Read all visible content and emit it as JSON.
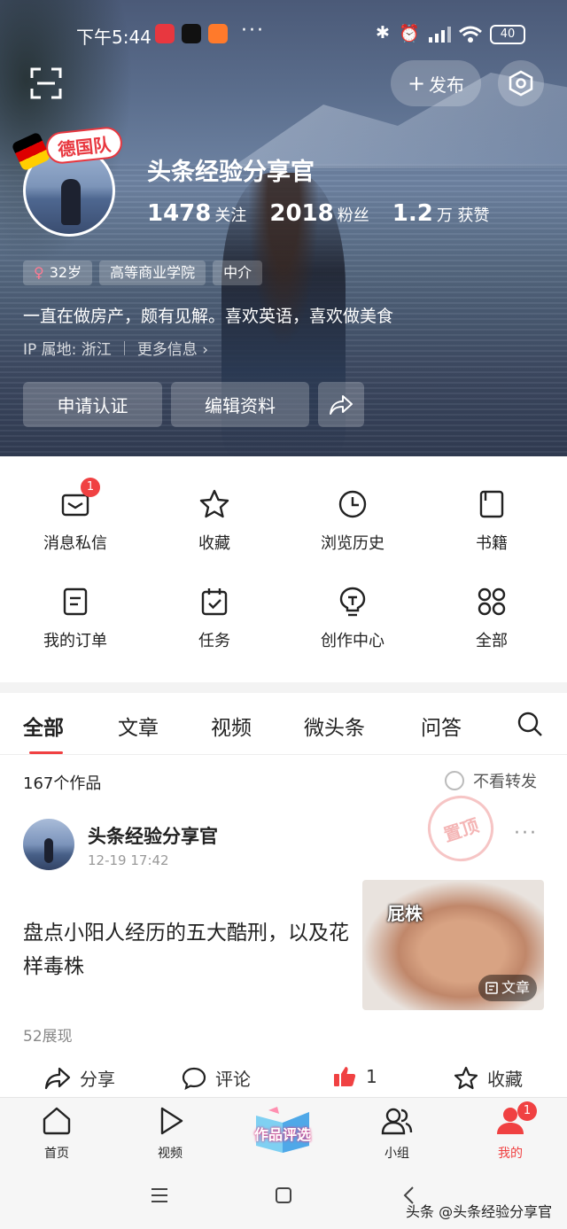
{
  "status_bar": {
    "time": "下午5:44",
    "more": "···",
    "battery": "40"
  },
  "header": {
    "publish_label": "发布",
    "badge_text": "德国队",
    "username": "头条经验分享官",
    "stats": [
      {
        "num": "1478",
        "unit": "关注"
      },
      {
        "num": "2018",
        "unit": "粉丝"
      },
      {
        "num": "1.2",
        "unit": "万 获赞"
      }
    ],
    "tags": [
      "32岁",
      "高等商业学院",
      "中介"
    ],
    "bio": "一直在做房产，颇有见解。喜欢英语，喜欢做美食",
    "ip": "IP 属地: 浙江",
    "more_info": "更多信息 ›",
    "apply_cert": "申请认证",
    "edit_profile": "编辑资料"
  },
  "grid": {
    "items": [
      {
        "label": "消息私信",
        "icon": "mail-icon",
        "badge": "1"
      },
      {
        "label": "收藏",
        "icon": "star-icon"
      },
      {
        "label": "浏览历史",
        "icon": "clock-icon"
      },
      {
        "label": "书籍",
        "icon": "book-icon"
      },
      {
        "label": "我的订单",
        "icon": "order-icon"
      },
      {
        "label": "任务",
        "icon": "calendar-check-icon"
      },
      {
        "label": "创作中心",
        "icon": "lightbulb-icon"
      },
      {
        "label": "全部",
        "icon": "grid-icon"
      }
    ]
  },
  "tabs": {
    "items": [
      "全部",
      "文章",
      "视频",
      "微头条",
      "问答"
    ],
    "active": "全部"
  },
  "feed": {
    "count": "167个作品",
    "no_forward": "不看转发",
    "post": {
      "author": "头条经验分享官",
      "time": "12-19 17:42",
      "pin_label": "置顶",
      "title": "盘点小阳人经历的五大酷刑，以及花样毒株",
      "thumb_caption": "屁株",
      "thumb_tag": "文章",
      "views": "52展现",
      "actions": {
        "share": "分享",
        "comment": "评论",
        "like_count": "1",
        "favorite": "收藏"
      }
    }
  },
  "bottom_nav": {
    "items": [
      {
        "label": "首页",
        "icon": "home-icon"
      },
      {
        "label": "视频",
        "icon": "play-icon"
      },
      {
        "label": "作品评选",
        "icon": "feature-icon"
      },
      {
        "label": "小组",
        "icon": "group-icon"
      },
      {
        "label": "我的",
        "icon": "profile-icon",
        "badge": "1"
      }
    ]
  },
  "watermark": "头条 @头条经验分享官",
  "colors": {
    "accent": "#f04142"
  }
}
